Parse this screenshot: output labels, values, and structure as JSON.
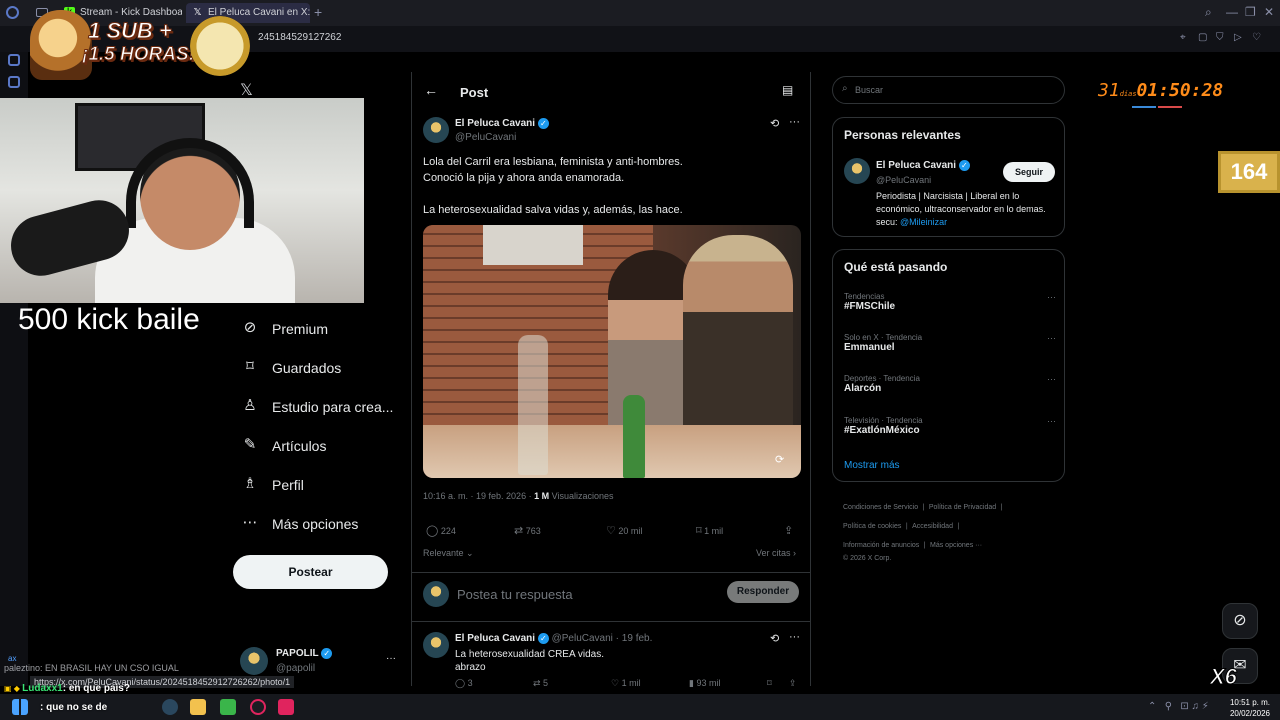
{
  "browser": {
    "tabs": [
      {
        "label": "Stream - Kick Dashboard",
        "icon": "kick-icon"
      },
      {
        "label": "El Peluca Cavani en X: \"Lo",
        "icon": "x-logo-icon"
      }
    ],
    "address_fragment": "245184529127262"
  },
  "nav": {
    "items": [
      {
        "label": "Premium",
        "icon": "premium-icon"
      },
      {
        "label": "Guardados",
        "icon": "bookmark-icon"
      },
      {
        "label": "Estudio para crea...",
        "icon": "creator-studio-icon"
      },
      {
        "label": "Artículos",
        "icon": "articles-icon"
      },
      {
        "label": "Perfil",
        "icon": "profile-icon"
      },
      {
        "label": "Más opciones",
        "icon": "more-options-icon"
      }
    ],
    "post_button": "Postear",
    "account_name": "PAPOLIL",
    "account_handle": "@papolil"
  },
  "main": {
    "header_title": "Post",
    "post": {
      "author": "El Peluca Cavani",
      "handle": "@PeluCavani",
      "text_line1": "Lola del Carril era lesbiana, feminista y anti-hombres.",
      "text_line2": "Conoció la pija y ahora anda enamorada.",
      "text_line3": "La heterosexualidad salva vidas y, además, las hace.",
      "timestamp": "10:16 a. m. · 19 feb. 2026 ·",
      "views_count": "1 M",
      "views_label": "Visualizaciones",
      "replies": "224",
      "reposts": "763",
      "likes": "20 mil",
      "bookmarks": "1 mil",
      "sort_label": "Relevante",
      "quotes_link": "Ver citas"
    },
    "reply_box": {
      "placeholder": "Postea tu respuesta",
      "button": "Responder"
    },
    "reply": {
      "author": "El Peluca Cavani",
      "handle": "@PeluCavani · 19 feb.",
      "text_line1": "La heterosexualidad CREA vidas.",
      "text_line2": "abrazo",
      "replies": "3",
      "reposts": "5",
      "likes": "1 mil",
      "views": "93 mil"
    }
  },
  "right": {
    "search_placeholder": "Buscar",
    "relevant": {
      "title": "Personas relevantes",
      "name": "El Peluca Cavani",
      "handle": "@PeluCavani",
      "follow": "Seguir",
      "bio": "Periodista | Narcisista | Liberal en lo económico, ultraconservador en lo demas. secu: ",
      "bio_link": "@Mileinizar"
    },
    "trending": {
      "title": "Qué está pasando",
      "items": [
        {
          "category": "Tendencias",
          "name": "#FMSChile"
        },
        {
          "category": "Solo en X · Tendencia",
          "name": "Emmanuel"
        },
        {
          "category": "Deportes · Tendencia",
          "name": "Alarcón"
        },
        {
          "category": "Televisión · Tendencia",
          "name": "#ExatlónMéxico"
        }
      ],
      "show_more": "Mostrar más"
    },
    "footer": {
      "terms": "Condiciones de Servicio",
      "privacy": "Política de Privacidad",
      "cookies": "Política de cookies",
      "accessibility": "Accesibilidad",
      "ads": "Información de anuncios",
      "more": "Más opciones ···",
      "copyright": "© 2026 X Corp."
    }
  },
  "stream_overlay": {
    "banner_line1": "1 SUB +",
    "banner_line2": "¡1.5 HORAS!",
    "kick_text": "500 kick baile",
    "timer_days": "31",
    "timer_days_label": "días",
    "timer_time": "01:50:28",
    "counter": "164",
    "multiplier": "X6",
    "chat_line1_user": "paleztino",
    "chat_line1_text": ": EN BRASIL HAY UN CSO IGUAL",
    "chat_line2_user": "Ludaxx1",
    "chat_line2_text": ": en que pais?",
    "chat_line3_text": ": que no se de",
    "chat_prefix": "ax",
    "status_url": "https://x.com/PeluCavani/status/2024518452912726262/photo/1"
  },
  "taskbar": {
    "time": "10:51 p. m.",
    "date": "20/02/2026"
  },
  "colors": {
    "accent": "#1d9bf0",
    "timer": "#ff8c1a",
    "counter_bg": "#d9b24c"
  }
}
